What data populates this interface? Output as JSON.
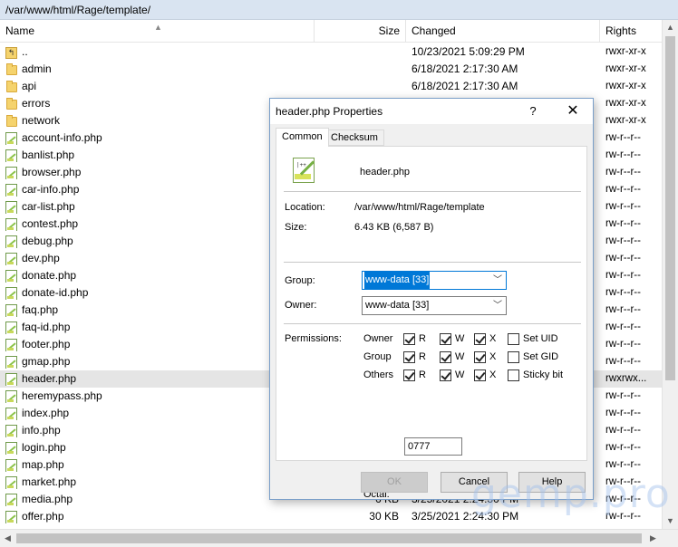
{
  "path": "/var/www/html/Rage/template/",
  "columns": {
    "name": "Name",
    "size": "Size",
    "changed": "Changed",
    "rights": "Rights"
  },
  "files": [
    {
      "icon": "parent-folder-icon",
      "name": "..",
      "size": "",
      "changed": "10/23/2021 5:09:29 PM",
      "rights": "rwxr-xr-x"
    },
    {
      "icon": "folder-icon",
      "name": "admin",
      "size": "",
      "changed": "6/18/2021 2:17:30 AM",
      "rights": "rwxr-xr-x"
    },
    {
      "icon": "folder-icon",
      "name": "api",
      "size": "",
      "changed": "6/18/2021 2:17:30 AM",
      "rights": "rwxr-xr-x"
    },
    {
      "icon": "folder-icon",
      "name": "errors",
      "size": "",
      "changed": "",
      "rights": "rwxr-xr-x"
    },
    {
      "icon": "folder-icon",
      "name": "network",
      "size": "",
      "changed": "",
      "rights": "rwxr-xr-x"
    },
    {
      "icon": "php-file-icon",
      "name": "account-info.php",
      "size": "",
      "changed": "",
      "rights": "rw-r--r--"
    },
    {
      "icon": "php-file-icon",
      "name": "banlist.php",
      "size": "",
      "changed": "",
      "rights": "rw-r--r--"
    },
    {
      "icon": "php-file-icon",
      "name": "browser.php",
      "size": "",
      "changed": "",
      "rights": "rw-r--r--"
    },
    {
      "icon": "php-file-icon",
      "name": "car-info.php",
      "size": "",
      "changed": "",
      "rights": "rw-r--r--"
    },
    {
      "icon": "php-file-icon",
      "name": "car-list.php",
      "size": "",
      "changed": "",
      "rights": "rw-r--r--"
    },
    {
      "icon": "php-file-icon",
      "name": "contest.php",
      "size": "",
      "changed": "",
      "rights": "rw-r--r--"
    },
    {
      "icon": "php-file-icon",
      "name": "debug.php",
      "size": "",
      "changed": "",
      "rights": "rw-r--r--"
    },
    {
      "icon": "php-file-icon",
      "name": "dev.php",
      "size": "",
      "changed": "",
      "rights": "rw-r--r--"
    },
    {
      "icon": "php-file-icon",
      "name": "donate.php",
      "size": "",
      "changed": "",
      "rights": "rw-r--r--"
    },
    {
      "icon": "php-file-icon",
      "name": "donate-id.php",
      "size": "",
      "changed": "",
      "rights": "rw-r--r--"
    },
    {
      "icon": "php-file-icon",
      "name": "faq.php",
      "size": "",
      "changed": "",
      "rights": "rw-r--r--"
    },
    {
      "icon": "php-file-icon",
      "name": "faq-id.php",
      "size": "",
      "changed": "",
      "rights": "rw-r--r--"
    },
    {
      "icon": "php-file-icon",
      "name": "footer.php",
      "size": "",
      "changed": "",
      "rights": "rw-r--r--"
    },
    {
      "icon": "php-file-icon",
      "name": "gmap.php",
      "size": "",
      "changed": "",
      "rights": "rw-r--r--"
    },
    {
      "icon": "php-file-icon",
      "name": "header.php",
      "size": "",
      "changed": "",
      "rights": "rwxrwx...",
      "selected": true
    },
    {
      "icon": "php-file-icon",
      "name": "heremypass.php",
      "size": "",
      "changed": "",
      "rights": "rw-r--r--"
    },
    {
      "icon": "php-file-icon",
      "name": "index.php",
      "size": "",
      "changed": "",
      "rights": "rw-r--r--"
    },
    {
      "icon": "php-file-icon",
      "name": "info.php",
      "size": "",
      "changed": "",
      "rights": "rw-r--r--"
    },
    {
      "icon": "php-file-icon",
      "name": "login.php",
      "size": "",
      "changed": "",
      "rights": "rw-r--r--"
    },
    {
      "icon": "php-file-icon",
      "name": "map.php",
      "size": "",
      "changed": "",
      "rights": "rw-r--r--"
    },
    {
      "icon": "php-file-icon",
      "name": "market.php",
      "size": "",
      "changed": "",
      "rights": "rw-r--r--"
    },
    {
      "icon": "php-file-icon",
      "name": "media.php",
      "size": "6 KB",
      "changed": "3/25/2021 2:24:30 PM",
      "rights": "rw-r--r--"
    },
    {
      "icon": "php-file-icon",
      "name": "offer.php",
      "size": "30 KB",
      "changed": "3/25/2021 2:24:30 PM",
      "rights": "rw-r--r--"
    }
  ],
  "dialog": {
    "title": "header.php Properties",
    "help_glyph": "?",
    "close_glyph": "✕",
    "tabs": [
      "Common",
      "Checksum"
    ],
    "file_name": "header.php",
    "location_label": "Location:",
    "location_value": "/var/www/html/Rage/template",
    "size_label": "Size:",
    "size_value": "6.43 KB (6,587 B)",
    "group_label": "Group:",
    "group_value": "www-data [33]",
    "owner_label": "Owner:",
    "owner_value": "www-data [33]",
    "permissions_label": "Permissions:",
    "perm_rows": [
      {
        "label": "Owner",
        "r": true,
        "w": true,
        "x": true,
        "extra": "Set UID",
        "extra_checked": false
      },
      {
        "label": "Group",
        "r": true,
        "w": true,
        "x": true,
        "extra": "Set GID",
        "extra_checked": false
      },
      {
        "label": "Others",
        "r": true,
        "w": true,
        "x": true,
        "extra": "Sticky bit",
        "extra_checked": false
      }
    ],
    "perm_letters": {
      "r": "R",
      "w": "W",
      "x": "X"
    },
    "octal_label": "Octal:",
    "octal_value": "0777",
    "buttons": {
      "ok": "OK",
      "cancel": "Cancel",
      "help": "Help"
    }
  },
  "watermark": "gemp.pro"
}
